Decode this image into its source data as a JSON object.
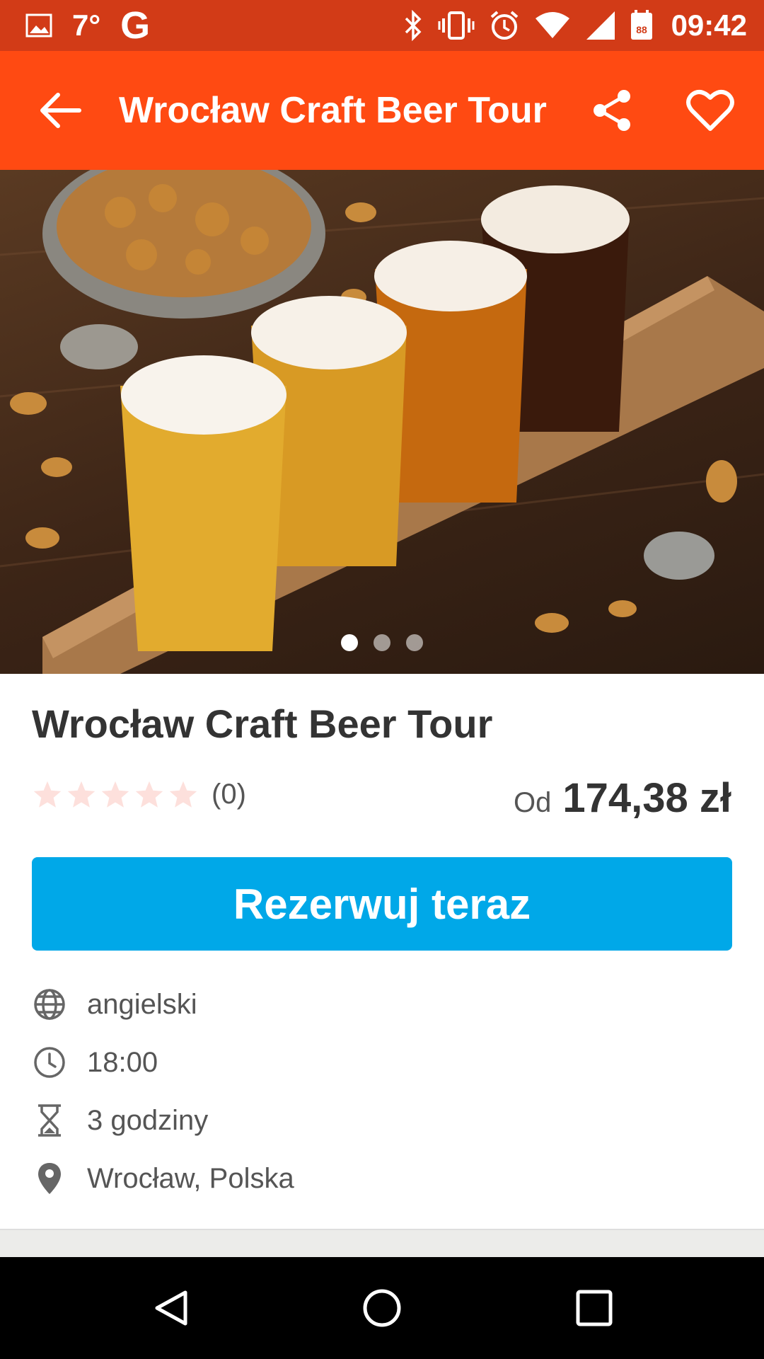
{
  "status_bar": {
    "temperature": "7°",
    "google_letter": "G",
    "time": "09:42",
    "calendar_day": "88",
    "icons": [
      "image-icon",
      "bluetooth-icon",
      "vibrate-icon",
      "alarm-icon",
      "wifi-icon",
      "signal-icon",
      "calendar-icon"
    ]
  },
  "toolbar": {
    "title": "Wrocław Craft Beer Tour",
    "icons": [
      "back-arrow-icon",
      "share-icon",
      "heart-icon"
    ]
  },
  "hero": {
    "slide_count": 3,
    "active_slide": 1
  },
  "tour": {
    "title": "Wrocław Craft Beer Tour",
    "rating_stars": 0,
    "max_stars": 5,
    "review_count": "(0)",
    "price_prefix": "Od",
    "price": "174,38 zł",
    "book_label": "Rezerwuj teraz",
    "details": [
      {
        "icon": "globe-icon",
        "text": "angielski"
      },
      {
        "icon": "clock-icon",
        "text": "18:00"
      },
      {
        "icon": "hourglass-icon",
        "text": "3 godziny"
      },
      {
        "icon": "location-pin-icon",
        "text": "Wrocław, Polska"
      }
    ]
  },
  "colors": {
    "status_bar": "#d23b17",
    "toolbar": "#ff4a12",
    "book_button": "#00a8e8",
    "star_empty": "#fde0dc"
  },
  "nav_bar": {
    "icons": [
      "nav-back-icon",
      "nav-home-icon",
      "nav-recents-icon"
    ]
  }
}
